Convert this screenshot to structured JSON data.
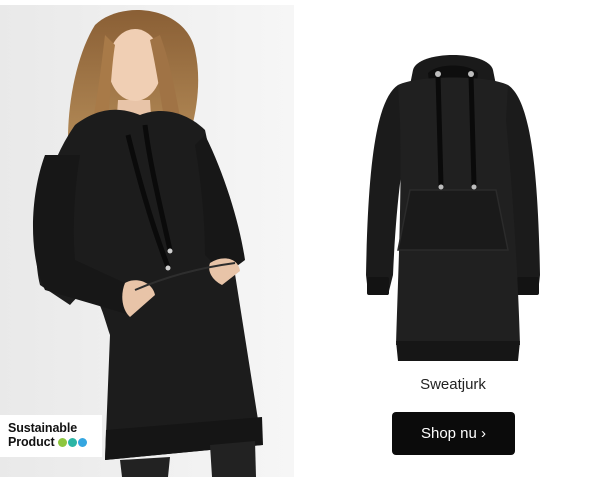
{
  "badge": {
    "line1": "Sustainable",
    "line2": "Product",
    "dot_colors": [
      "#8dc63f",
      "#2bb5a5",
      "#35a6e0"
    ]
  },
  "product": {
    "name": "Sweatjurk",
    "button_label": "Shop nu ›"
  },
  "colors": {
    "button_bg": "#0b0b0b",
    "garment": "#1c1c1c"
  }
}
